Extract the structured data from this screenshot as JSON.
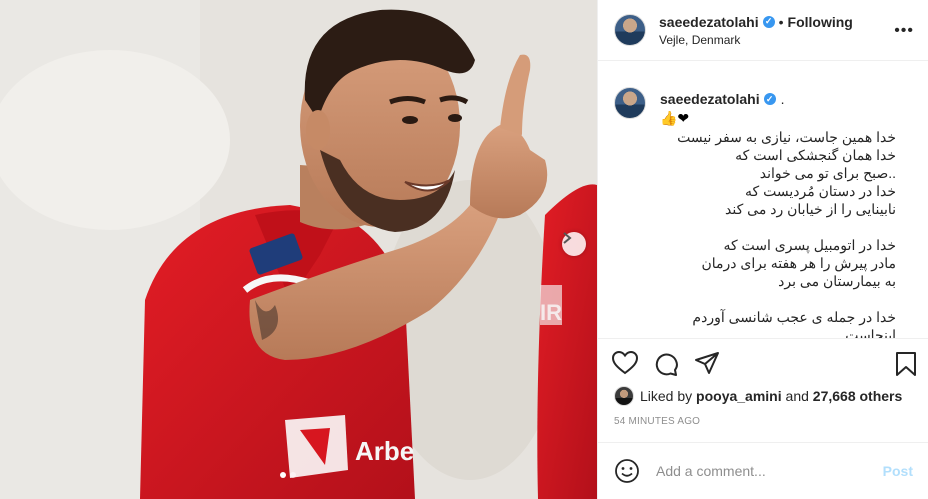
{
  "header": {
    "username": "saeedezatolahi",
    "separator": "•",
    "follow_status": "Following",
    "location": "Vejle, Denmark",
    "more_icon": "more-horizontal-icon"
  },
  "caption": {
    "username": "saeedezatolahi",
    "suffix": ".",
    "emoji": "👍❤",
    "paragraphs": [
      [
        "خدا همین جاست، نیازی به سفر نیست",
        "خدا همان گنجشکی است که",
        "..صبح برای تو می خواند",
        "خدا در دستان مُردیست که",
        "نابینایی را از خیابان رد می کند"
      ],
      [
        "خدا در اتومبیل پسری است که",
        "مادر پیرش را هر هفته برای درمان",
        "به بیمارستان می برد"
      ],
      [
        "خدا در جمله ی عجب شانسی آوردم",
        "اینجاست"
      ]
    ]
  },
  "likes": {
    "prefix": "Liked by",
    "user": "pooya_amini",
    "and": "and",
    "count": "27,668 others"
  },
  "timestamp": "54 MINUTES AGO",
  "comment": {
    "placeholder": "Add a comment...",
    "post_label": "Post"
  },
  "carousel": {
    "total": 2,
    "active": 0
  },
  "colors": {
    "accent": "#3897f0",
    "jersey": "#d7161f",
    "post_disabled": "#b2dffc",
    "heart": "#ed4956"
  }
}
